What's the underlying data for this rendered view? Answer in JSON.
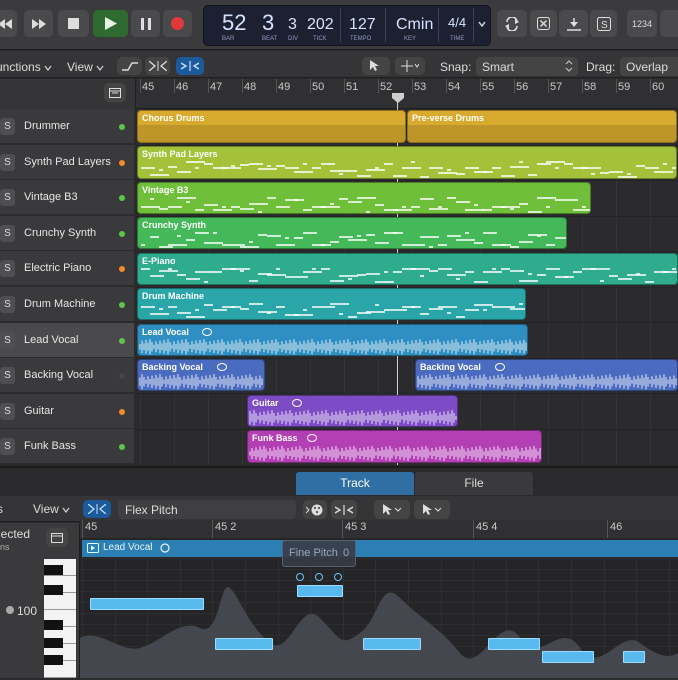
{
  "transport": {
    "bar": "52",
    "beat": "3",
    "div": "3",
    "tick": "202",
    "tempo": "127",
    "key": "Cmin",
    "sig_top": "4",
    "sig_bottom": "4",
    "bar_lbl": "BAR",
    "beat_lbl": "BEAT",
    "div_lbl": "DIV",
    "tick_lbl": "TICK",
    "tempo_lbl": "TEMPO",
    "key_lbl": "KEY",
    "time_lbl": "TIME",
    "lcd_count": "1234"
  },
  "toolbar": {
    "functions": "unctions",
    "view": "View",
    "snap_label": "Snap:",
    "snap_value": "Smart",
    "drag_label": "Drag:",
    "drag_value": "Overlap"
  },
  "ruler": [
    "45",
    "46",
    "47",
    "48",
    "49",
    "50",
    "51",
    "52",
    "53",
    "54",
    "55",
    "56",
    "57",
    "58",
    "59",
    "60"
  ],
  "tracks": [
    {
      "name": "Drummer",
      "s": "S",
      "dot": "#5ec44a"
    },
    {
      "name": "Synth Pad Layers",
      "s": "S",
      "dot": "#f08a2a"
    },
    {
      "name": "Vintage B3",
      "s": "S",
      "dot": "#5ec44a"
    },
    {
      "name": "Crunchy Synth",
      "s": "S",
      "dot": "#5ec44a"
    },
    {
      "name": "Electric Piano",
      "s": "S",
      "dot": "#f08a2a"
    },
    {
      "name": "Drum Machine",
      "s": "S",
      "dot": "#5ec44a"
    },
    {
      "name": "Lead Vocal",
      "s": "S",
      "dot": "#5ec44a"
    },
    {
      "name": "Backing Vocal",
      "s": "S",
      "dot": "#444444"
    },
    {
      "name": "Guitar",
      "s": "S",
      "dot": "#f08a2a"
    },
    {
      "name": "Funk Bass",
      "s": "S",
      "dot": "#5ec44a"
    }
  ],
  "regions": {
    "chorus": "Chorus Drums",
    "preverse": "Pre-verse Drums",
    "synthpad": "Synth Pad Layers",
    "b3": "Vintage B3",
    "crunchy": "Crunchy Synth",
    "epiano": "E-Piano",
    "drummachine": "Drum Machine",
    "leadvocal": "Lead Vocal",
    "backing1": "Backing Vocal",
    "backing2": "Backing Vocal",
    "guitar": "Guitar",
    "funkbass": "Funk Bass"
  },
  "editor": {
    "tab_track": "Track",
    "tab_file": "File",
    "view": "View",
    "mode": "Flex Pitch",
    "selected": "lected",
    "selected_sub": "ns",
    "volume": "100",
    "ruler": [
      "45",
      "45 2",
      "45 3",
      "45 4",
      "46"
    ],
    "region": "Lead Vocal",
    "tooltip": "Fine Pitch",
    "tooltip_val": "0"
  },
  "colors": {
    "drums": "#d8aa2e",
    "synth": "#a3c23a",
    "b3": "#6fbf3a",
    "crunchy": "#45b85a",
    "epiano": "#2fab8e",
    "dm": "#2ba6a8",
    "lead": "#2f8fc2",
    "backing": "#4a6bbf",
    "guitar": "#7d4bc6",
    "bass": "#b23fb3"
  }
}
